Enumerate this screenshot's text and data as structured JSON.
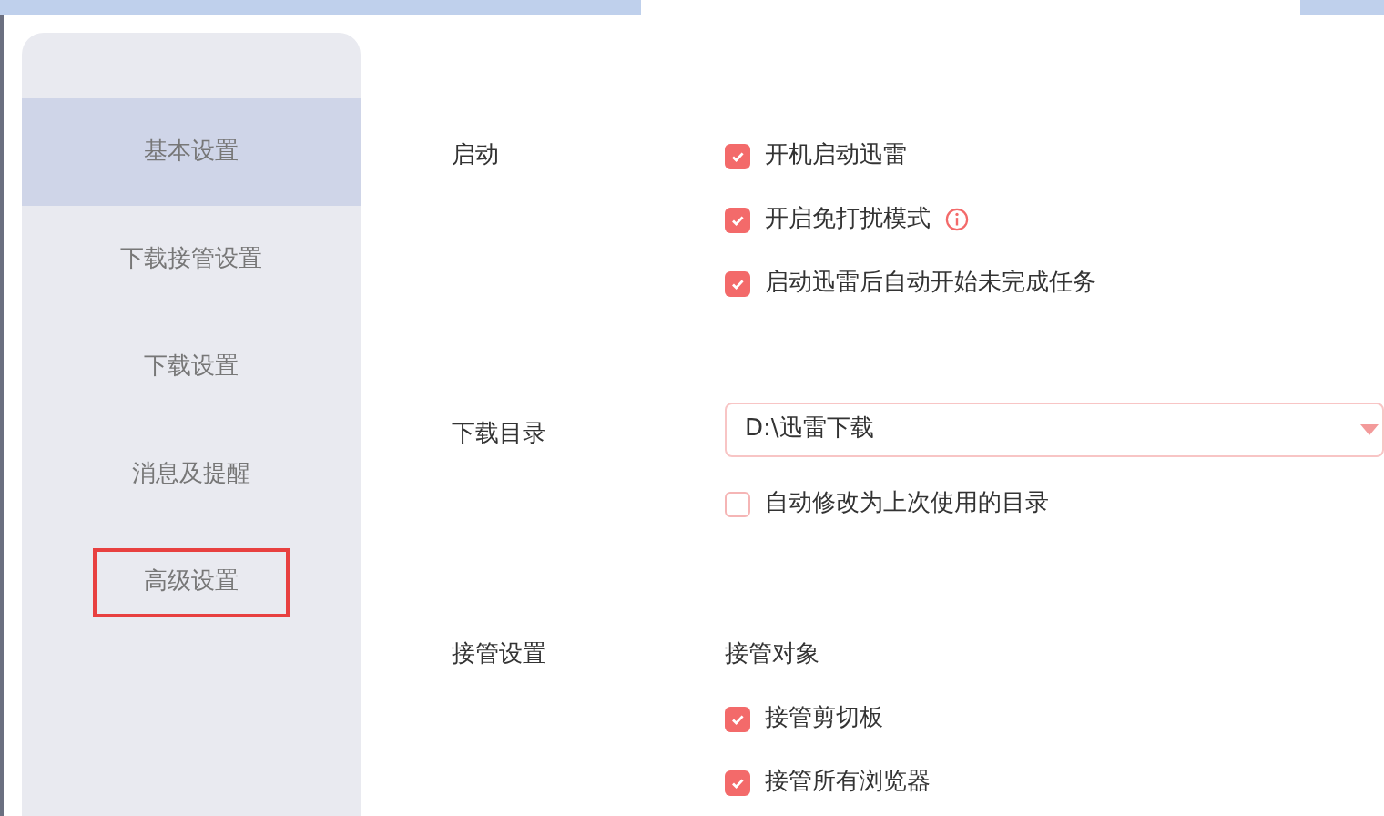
{
  "sidebar": {
    "items": [
      {
        "label": "基本设置",
        "selected": true,
        "highlighted": false
      },
      {
        "label": "下载接管设置",
        "selected": false,
        "highlighted": false
      },
      {
        "label": "下载设置",
        "selected": false,
        "highlighted": false
      },
      {
        "label": "消息及提醒",
        "selected": false,
        "highlighted": false
      },
      {
        "label": "高级设置",
        "selected": false,
        "highlighted": true
      }
    ]
  },
  "sections": [
    {
      "label": "启动",
      "rows": [
        {
          "kind": "checkbox",
          "label": "开机启动迅雷",
          "checked": true,
          "info": false
        },
        {
          "kind": "checkbox",
          "label": "开启免打扰模式",
          "checked": true,
          "info": true
        },
        {
          "kind": "checkbox",
          "label": "启动迅雷后自动开始未完成任务",
          "checked": true,
          "info": false
        }
      ]
    },
    {
      "label": "下载目录",
      "rows": [
        {
          "kind": "dropdown",
          "value": "D:\\迅雷下载"
        },
        {
          "kind": "checkbox",
          "label": "自动修改为上次使用的目录",
          "checked": false,
          "info": false
        }
      ]
    },
    {
      "label": "接管设置",
      "rows": [
        {
          "kind": "heading",
          "label": "接管对象"
        },
        {
          "kind": "checkbox",
          "label": "接管剪切板",
          "checked": true,
          "info": false
        },
        {
          "kind": "checkbox",
          "label": "接管所有浏览器",
          "checked": true,
          "info": false
        }
      ]
    }
  ]
}
